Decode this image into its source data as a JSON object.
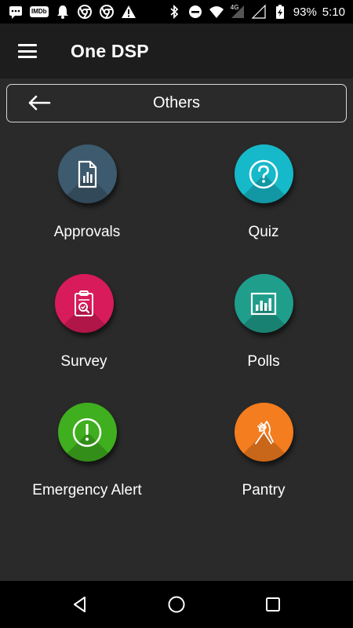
{
  "status_bar": {
    "imdb_label": "IMDb",
    "battery_percent": "93%",
    "time": "5:10",
    "network_label": "4G"
  },
  "app_bar": {
    "title": "One DSP"
  },
  "section": {
    "title": "Others"
  },
  "tiles": [
    {
      "label": "Approvals",
      "icon": "report-document-icon",
      "color": "#3d5a6e"
    },
    {
      "label": "Quiz",
      "icon": "question-mark-icon",
      "color": "#16b9c9"
    },
    {
      "label": "Survey",
      "icon": "clipboard-check-icon",
      "color": "#d81b5a"
    },
    {
      "label": "Polls",
      "icon": "bar-chart-icon",
      "color": "#1f9e8c"
    },
    {
      "label": "Emergency Alert",
      "icon": "alert-exclamation-icon",
      "color": "#3fae1f"
    },
    {
      "label": "Pantry",
      "icon": "fork-knife-icon",
      "color": "#f47d1f"
    }
  ]
}
